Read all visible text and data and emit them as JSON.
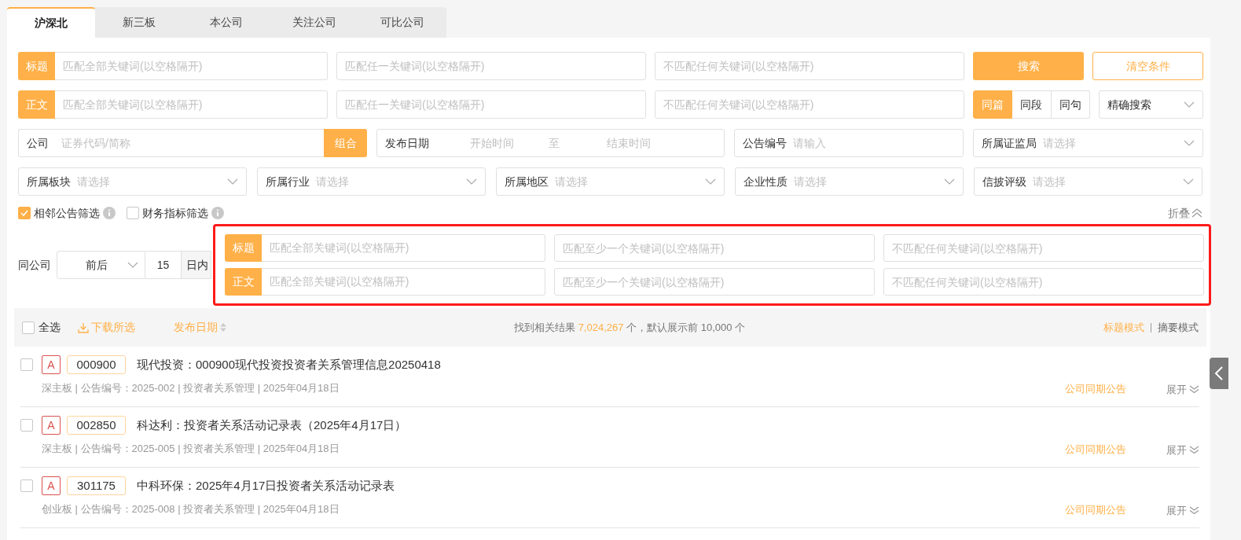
{
  "tabs": [
    {
      "label": "沪深北",
      "selected": true
    },
    {
      "label": "新三板",
      "selected": false
    },
    {
      "label": "本公司",
      "selected": false
    },
    {
      "label": "关注公司",
      "selected": false
    },
    {
      "label": "可比公司",
      "selected": false
    }
  ],
  "keyword_rows": [
    {
      "label": "标题",
      "placeholders": [
        "匹配全部关键词(以空格隔开)",
        "匹配任一关键词(以空格隔开)",
        "不匹配任何关键词(以空格隔开)"
      ]
    },
    {
      "label": "正文",
      "placeholders": [
        "匹配全部关键词(以空格隔开)",
        "匹配任一关键词(以空格隔开)",
        "不匹配任何关键词(以空格隔开)"
      ]
    }
  ],
  "search_button": "搜索",
  "clear_button": "清空条件",
  "scope_toggle": [
    {
      "label": "同篇",
      "selected": true
    },
    {
      "label": "同段",
      "selected": false
    },
    {
      "label": "同句",
      "selected": false
    }
  ],
  "match_mode": "精确搜索",
  "company": {
    "label": "公司",
    "placeholder": "证券代码/简称",
    "button": "组合"
  },
  "publish_date": {
    "label": "发布日期",
    "start_placeholder": "开始时间",
    "separator": "至",
    "end_placeholder": "结束时间"
  },
  "announcement_no": {
    "label": "公告编号",
    "placeholder": "请输入"
  },
  "regulator_select": {
    "label": "所属证监局",
    "placeholder": "请选择"
  },
  "selects": [
    {
      "label": "所属板块",
      "placeholder": "请选择"
    },
    {
      "label": "所属行业",
      "placeholder": "请选择"
    },
    {
      "label": "所属地区",
      "placeholder": "请选择"
    },
    {
      "label": "企业性质",
      "placeholder": "请选择"
    },
    {
      "label": "信披评级",
      "placeholder": "请选择"
    }
  ],
  "filters": [
    {
      "label": "相邻公告筛选",
      "checked": true
    },
    {
      "label": "财务指标筛选",
      "checked": false
    }
  ],
  "collapse": "折叠",
  "same_company": {
    "label": "同公司",
    "direction": "前后",
    "days": "15",
    "unit": "日内"
  },
  "popup_rows": [
    {
      "label": "标题",
      "placeholders": [
        "匹配全部关键词(以空格隔开)",
        "匹配至少一个关键词(以空格隔开)",
        "不匹配任何关键词(以空格隔开)"
      ]
    },
    {
      "label": "正文",
      "placeholders": [
        "匹配全部关键词(以空格隔开)",
        "匹配至少一个关键词(以空格隔开)",
        "不匹配任何关键词(以空格隔开)"
      ]
    }
  ],
  "list_header": {
    "select_all": {
      "label": "全选",
      "checked": false
    },
    "download": "下载所选",
    "sort": "发布日期",
    "result_prefix": "找到相关结果",
    "result_count": "7,024,267",
    "result_suffix": "个，默认展示前 10,000 个",
    "modes": [
      {
        "label": "标题模式",
        "selected": true
      },
      {
        "label": "摘要模式",
        "selected": false
      }
    ]
  },
  "results": [
    {
      "checked": false,
      "market": "A",
      "code": "000900",
      "title": "现代投资：000900现代投资投资者关系管理信息20250418",
      "meta": "深主板 | 公告编号：2025-002 | 投资者关系管理 | 2025年04月18日",
      "peer_link": "公司同期公告",
      "expand": "展开"
    },
    {
      "checked": false,
      "market": "A",
      "code": "002850",
      "title": "科达利：投资者关系活动记录表（2025年4月17日）",
      "meta": "深主板 | 公告编号：2025-005 | 投资者关系管理 | 2025年04月18日",
      "peer_link": "公司同期公告",
      "expand": "展开"
    },
    {
      "checked": false,
      "market": "A",
      "code": "301175",
      "title": "中科环保：2025年4月17日投资者关系活动记录表",
      "meta": "创业板 | 公告编号：2025-008 | 投资者关系管理 | 2025年04月18日",
      "peer_link": "公司同期公告",
      "expand": "展开"
    }
  ]
}
